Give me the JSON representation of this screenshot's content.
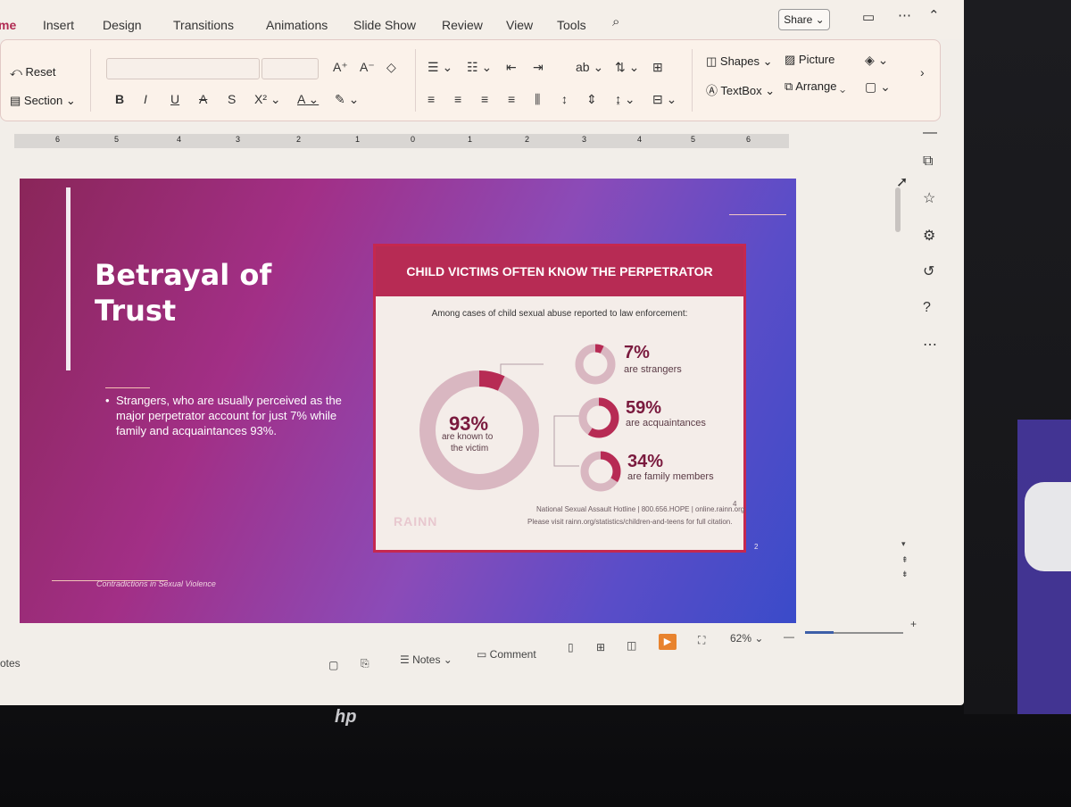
{
  "menu": {
    "tabs": [
      "me",
      "Insert",
      "Design",
      "Transitions",
      "Animations",
      "Slide Show",
      "Review",
      "View",
      "Tools"
    ],
    "active_tab": "me",
    "share_label": "Share"
  },
  "ribbon": {
    "reset_label": "Reset",
    "section_label": "Section",
    "shapes_label": "Shapes",
    "picture_label": "Picture",
    "textbox_label": "TextBox",
    "arrange_label": "Arrange"
  },
  "ruler": {
    "numbers": [
      "6",
      "5",
      "4",
      "3",
      "2",
      "1",
      "0",
      "1",
      "2",
      "3",
      "4",
      "5",
      "6"
    ]
  },
  "slide": {
    "title_line1": "Betrayal of",
    "title_line2": "Trust",
    "bullet": "Strangers, who are usually perceived as the major perpetrator account for just 7% while family and acquaintances 93%.",
    "footer": "Contradictions in Sexual Violence",
    "page_number": "2"
  },
  "infographic": {
    "heading": "CHILD VICTIMS OFTEN KNOW THE PERPETRATOR",
    "subheading": "Among cases of child sexual abuse reported to law enforcement:",
    "main": {
      "value": "93%",
      "label_line1": "are known to",
      "label_line2": "the victim",
      "fraction": 0.93
    },
    "items": [
      {
        "value": "7%",
        "label": "are strangers",
        "fraction": 0.07
      },
      {
        "value": "59%",
        "label": "are acquaintances",
        "fraction": 0.59
      },
      {
        "value": "34%",
        "label": "are family members",
        "fraction": 0.34
      }
    ],
    "source_line1": "National Sexual Assault Hotline | 800.656.HOPE | online.rainn.org",
    "source_line2": "Please visit rainn.org/statistics/children-and-teens for full citation.",
    "footnote": "4",
    "logo_text": "RAINN"
  },
  "status": {
    "notes_left": "otes",
    "notes_label": "Notes",
    "comment_label": "Comment",
    "zoom": "62%"
  },
  "colors": {
    "accent": "#b02a52",
    "ring_dark": "#b72b54",
    "ring_light": "#d9b7c1"
  },
  "brand": "hp"
}
